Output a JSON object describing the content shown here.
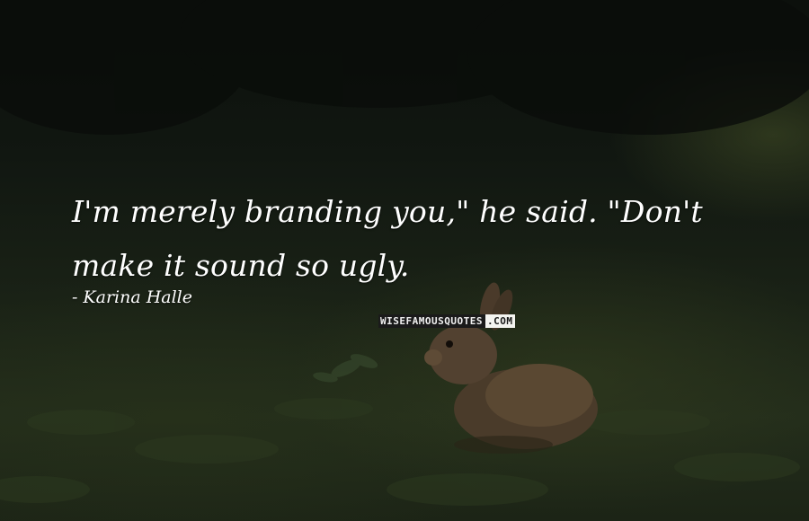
{
  "quote": {
    "line1": "I'm merely branding you,\" he said. \"Don't",
    "line2": "make it sound so ugly."
  },
  "author": {
    "dash": "-",
    "name": "Karina Halle"
  },
  "watermark": {
    "dark_part": "WISEFAMOUSQUOTES",
    "light_part": ".COM"
  },
  "colors": {
    "text": "#ffffff",
    "background": "#151b14"
  }
}
